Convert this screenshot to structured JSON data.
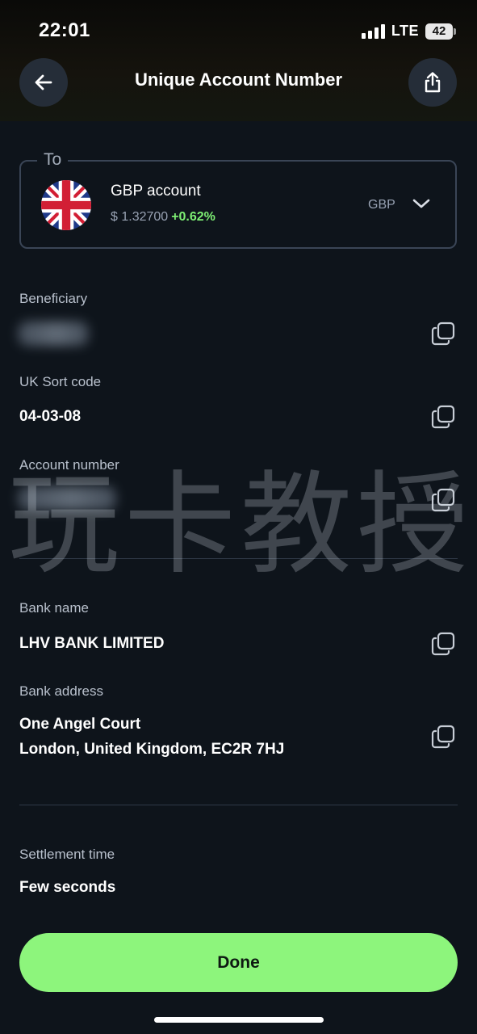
{
  "status_bar": {
    "time": "22:01",
    "network": "LTE",
    "battery": "42"
  },
  "header": {
    "title": "Unique Account Number",
    "back_icon": "arrow-left-icon",
    "share_icon": "share-icon"
  },
  "to_account": {
    "label": "To",
    "flag_icon": "uk-flag-icon",
    "name": "GBP account",
    "rate": "$ 1.32700",
    "change": "+0.62%",
    "change_color": "#7dee73",
    "currency": "GBP"
  },
  "fields": {
    "beneficiary": {
      "label": "Beneficiary"
    },
    "sort_code": {
      "label": "UK Sort code",
      "value": "04-03-08"
    },
    "account_number": {
      "label": "Account number"
    },
    "bank_name": {
      "label": "Bank name",
      "value": "LHV BANK LIMITED"
    },
    "bank_address": {
      "label": "Bank address",
      "line1": "One Angel Court",
      "line2": "London, United Kingdom, EC2R 7HJ"
    },
    "settlement": {
      "label": "Settlement time",
      "value": "Few seconds"
    }
  },
  "watermark": "玩卡教授",
  "done": {
    "label": "Done",
    "color": "#8df57c"
  }
}
